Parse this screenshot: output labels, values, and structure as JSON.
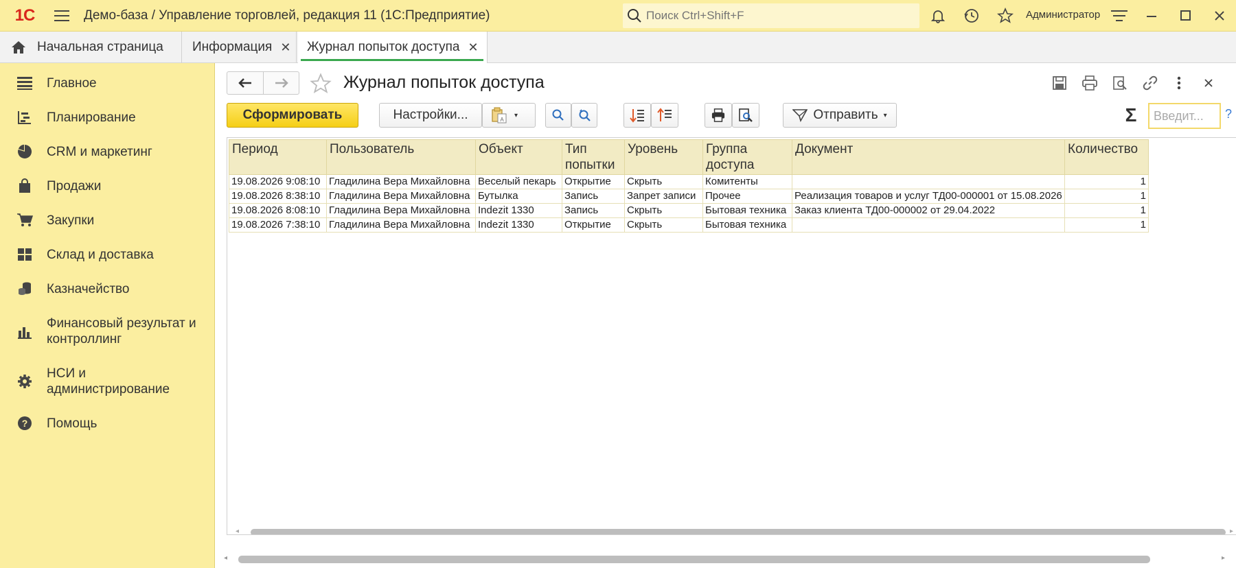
{
  "titlebar": {
    "logo_text": "1С",
    "title": "Демо-база / Управление торговлей, редакция 11  (1С:Предприятие)",
    "search_placeholder": "Поиск Ctrl+Shift+F",
    "user": "Администратор",
    "icons": [
      "bell-icon",
      "history-icon",
      "star-icon",
      "settings-lines-icon",
      "minimize-icon",
      "maximize-icon",
      "close-icon"
    ]
  },
  "tabs": [
    {
      "label": "Начальная страница",
      "icon": "home-icon"
    },
    {
      "label": "Информация",
      "closable": true
    },
    {
      "label": "Журнал попыток доступа",
      "closable": true,
      "active": true
    }
  ],
  "sidebar": {
    "items": [
      {
        "label": "Главное",
        "icon": "list-icon"
      },
      {
        "label": "Планирование",
        "icon": "planning-icon"
      },
      {
        "label": "CRM и маркетинг",
        "icon": "pie-icon"
      },
      {
        "label": "Продажи",
        "icon": "bag-icon"
      },
      {
        "label": "Закупки",
        "icon": "cart-icon"
      },
      {
        "label": "Склад и доставка",
        "icon": "warehouse-icon"
      },
      {
        "label": "Казначейство",
        "icon": "coins-icon"
      },
      {
        "label": "Финансовый результат и контроллинг",
        "icon": "bar-chart-icon"
      },
      {
        "label": "НСИ и администрирование",
        "icon": "gear-icon"
      },
      {
        "label": "Помощь",
        "icon": "help-icon"
      }
    ]
  },
  "form": {
    "title": "Журнал попыток доступа",
    "generate_button": "Сформировать",
    "settings_button": "Настройки...",
    "send_button": "Отправить",
    "filter_placeholder": "Введит...",
    "help": "?",
    "sigma": "Σ"
  },
  "table": {
    "columns": [
      "Период",
      "Пользователь",
      "Объект",
      "Тип попытки",
      "Уровень",
      "Группа доступа",
      "Документ",
      "Количество"
    ],
    "rows": [
      [
        "19.08.2026 9:08:10",
        "Гладилина Вера Михайловна",
        "Веселый пекарь",
        "Открытие",
        "Скрыть",
        "Комитенты",
        "",
        "1"
      ],
      [
        "19.08.2026 8:38:10",
        "Гладилина Вера Михайловна",
        "Бутылка",
        "Запись",
        "Запрет записи",
        "Прочее",
        "Реализация товаров и услуг ТД00-000001 от 15.08.2026",
        "1"
      ],
      [
        "19.08.2026 8:08:10",
        "Гладилина Вера Михайловна",
        "Indezit 1330",
        "Запись",
        "Скрыть",
        "Бытовая техника",
        "Заказ клиента ТД00-000002 от 29.04.2022",
        "1"
      ],
      [
        "19.08.2026 7:38:10",
        "Гладилина Вера Михайловна",
        "Indezit 1330",
        "Открытие",
        "Скрыть",
        "Бытовая техника",
        "",
        "1"
      ]
    ]
  },
  "colors": {
    "accent_yellow": "#fbeea0",
    "primary_button": "#f5cf16",
    "active_tab_underline": "#3aa84f",
    "logo_red": "#d9261c"
  }
}
